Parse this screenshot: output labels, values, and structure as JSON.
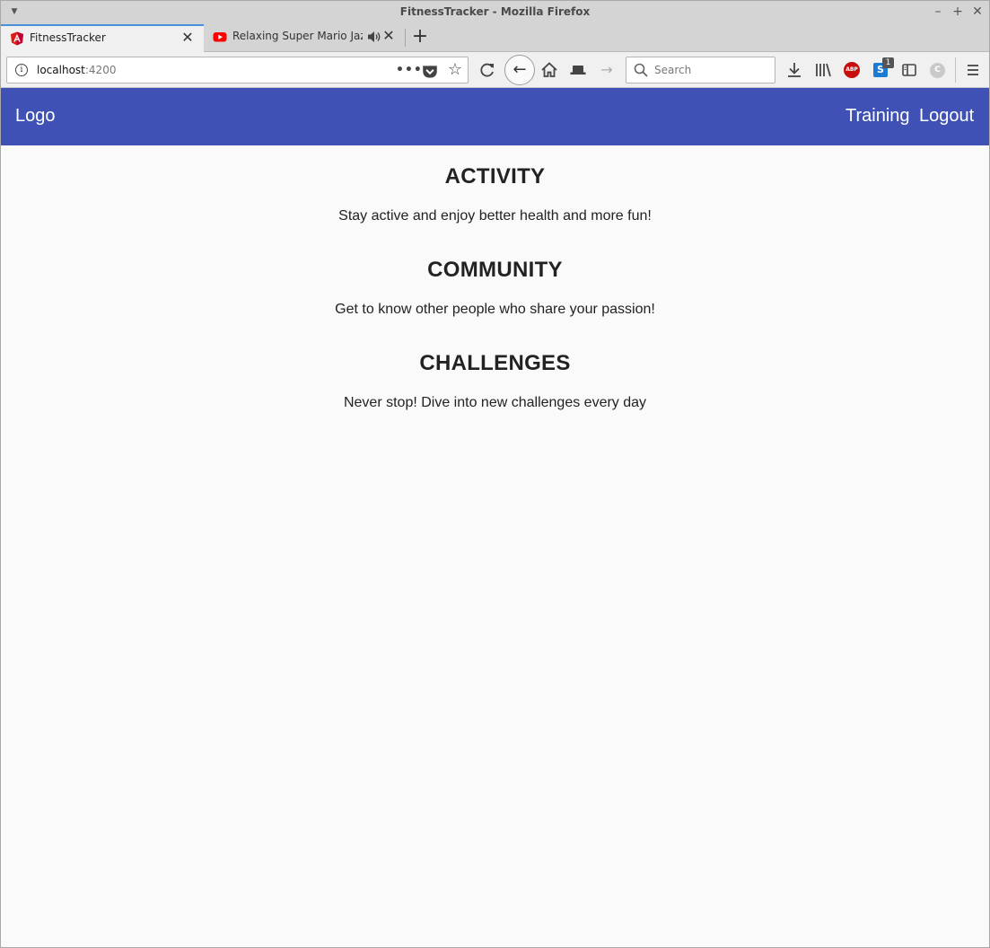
{
  "browser": {
    "window_title": "FitnessTracker - Mozilla Firefox",
    "tabs": [
      {
        "label": "FitnessTracker",
        "favicon": "angular-icon",
        "active": true
      },
      {
        "label": "Relaxing Super Mario Jazz",
        "favicon": "youtube-icon",
        "active": false,
        "audio": true
      }
    ],
    "url_host": "localhost",
    "url_port": ":4200",
    "search_placeholder": "Search",
    "extension_badge": "1",
    "abp_label": "ABP",
    "s_label": "S"
  },
  "app": {
    "brand_color": "#3f51b5",
    "logo": "Logo",
    "nav": {
      "training": "Training",
      "logout": "Logout"
    },
    "sections": [
      {
        "title": "ACTIVITY",
        "text": "Stay active and enjoy better health and more fun!"
      },
      {
        "title": "COMMUNITY",
        "text": "Get to know other people who share your passion!"
      },
      {
        "title": "CHALLENGES",
        "text": "Never stop! Dive into new challenges every day"
      }
    ]
  }
}
